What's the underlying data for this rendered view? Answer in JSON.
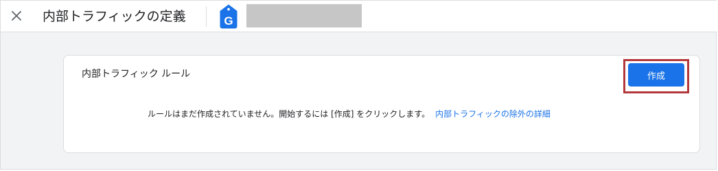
{
  "header": {
    "title": "内部トラフィックの定義",
    "property_name": ""
  },
  "card": {
    "title": "内部トラフィック ルール",
    "create_button": "作成",
    "empty_message": "ルールはまだ作成されていません。開始するには [作成] をクリックします。",
    "learn_more_link": "内部トラフィックの除外の詳細"
  },
  "icons": {
    "close": "close-icon",
    "tag": "google-tag-icon"
  },
  "colors": {
    "accent": "#1a73e8",
    "highlight": "#b3383b",
    "background": "#f1f3f4"
  }
}
